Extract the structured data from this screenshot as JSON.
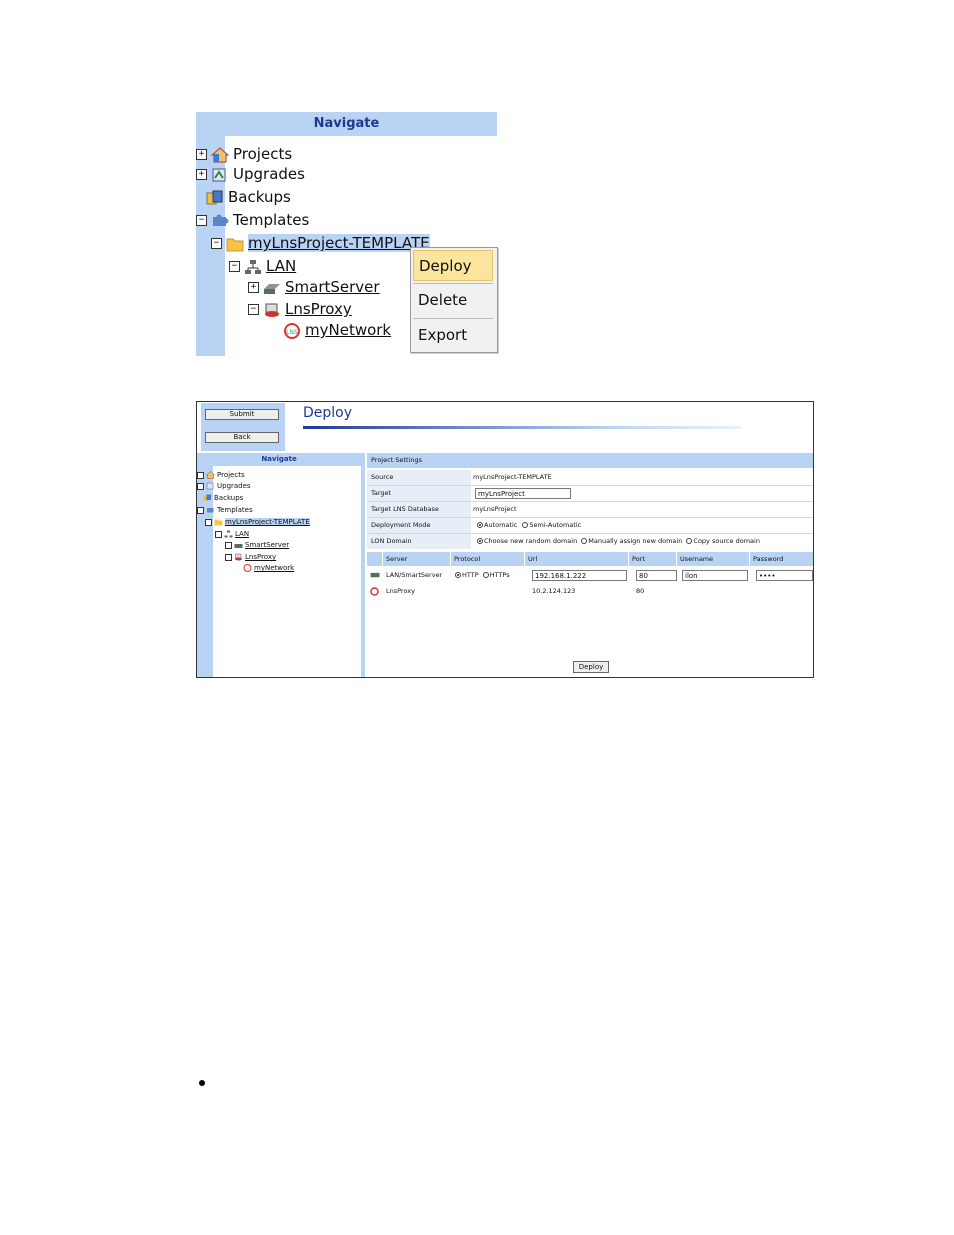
{
  "nav_panel": {
    "header": "Navigate",
    "tree": {
      "projects": "Projects",
      "upgrades": "Upgrades",
      "backups": "Backups",
      "templates": "Templates",
      "template_project": "myLnsProject-TEMPLATE",
      "lan": "LAN",
      "smartserver": "SmartServer",
      "lnsproxy": "LnsProxy",
      "mynetwork": "myNetwork"
    },
    "expander_plus": "+",
    "expander_minus": "−"
  },
  "context_menu": {
    "items": [
      "Deploy",
      "Delete",
      "Export"
    ]
  },
  "deploy_window": {
    "buttons": {
      "submit": "Submit",
      "back": "Back"
    },
    "title": "Deploy",
    "project_settings": {
      "header": "Project Settings",
      "source_label": "Source",
      "source_value": "myLnsProject-TEMPLATE",
      "target_label": "Target",
      "target_value": "myLnsProject",
      "target_db_label": "Target LNS Database",
      "target_db_value": "myLnsProject",
      "deploy_mode_label": "Deployment Mode",
      "deploy_mode_options": [
        "Automatic",
        "Semi-Automatic"
      ],
      "lon_domain_label": "LON Domain",
      "lon_domain_options": [
        "Choose new random domain",
        "Manually assign new domain",
        "Copy source domain"
      ]
    },
    "servers_table": {
      "columns": [
        "Server",
        "Protocol",
        "Url",
        "Port",
        "Username",
        "Password"
      ],
      "rows": [
        {
          "server": "LAN/SmartServer",
          "protocol_options": [
            "HTTP",
            "HTTPs"
          ],
          "url": "192.168.1.222",
          "port": "80",
          "username": "ilon",
          "password": "••••"
        },
        {
          "server": "LnsProxy",
          "url": "10.2.124.123",
          "port": "80"
        }
      ]
    },
    "deploy_button": "Deploy"
  },
  "colors": {
    "header_bg": "#b9d3f4",
    "header_text": "#1f3a93",
    "menu_highlight": "#fbe49d"
  }
}
